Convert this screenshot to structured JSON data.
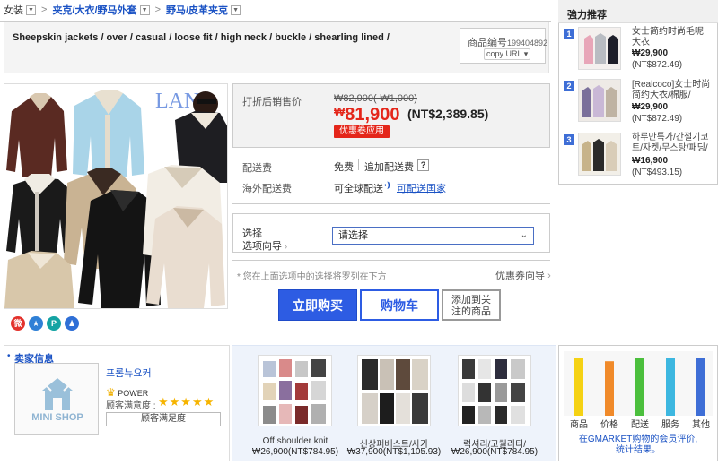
{
  "breadcrumb": {
    "items": [
      "女装",
      "夹克/大衣/野马外套",
      "野马/皮革夹克"
    ]
  },
  "product": {
    "title": "Sheepskin jackets / over / casual / loose fit / high neck / buckle / shearling lined /",
    "code_label": "商品编号",
    "code_value": "199404892",
    "copy_label": "copy URL"
  },
  "price": {
    "label": "打折后销售价",
    "original": "₩82,900(-₩1,000)",
    "currency_symbol": "₩",
    "current": "81,900",
    "nt": "(NT$2,389.85)",
    "coupon_button": "优惠卷应用"
  },
  "shipping": {
    "fee_label": "配送费",
    "fee_value": "免费",
    "extra_label": "追加配送费",
    "help_icon": "?",
    "overseas_label": "海外配送费",
    "overseas_value": "可全球配送",
    "countries_link": "可配送国家"
  },
  "options": {
    "label_line1": "选择",
    "label_line2": "选项向导",
    "select_placeholder": "请选择",
    "note": "* 您在上面选项中的选择将罗列在下方",
    "coupon_guide": "优惠券向导"
  },
  "actions": {
    "buy_now": "立即购买",
    "cart": "购物车",
    "favorite_line1": "添加到关",
    "favorite_line2": "注的商品"
  },
  "sidebar": {
    "title": "強力推荐",
    "items": [
      {
        "rank": "1",
        "title": "女士简约时尚毛呢大衣",
        "price": "₩29,900",
        "nt": "(NT$872.49)"
      },
      {
        "rank": "2",
        "title": "[Realcoco]女士时尚简约大衣/棉服/",
        "price": "₩29,900",
        "nt": "(NT$872.49)"
      },
      {
        "rank": "3",
        "title": "하루만특가/간절기코트/자켓/무스탕/패딩/",
        "price": "₩16,900",
        "nt": "(NT$493.15)"
      }
    ]
  },
  "seller": {
    "section_title": "卖家信息",
    "shop_label": "MINI SHOP",
    "shop_name": "프롬뉴요커",
    "power_label": "POWER",
    "satisfaction_label": "顾客满意度 :",
    "stars": "★★★★★",
    "satisfaction_button": "顾客满足度"
  },
  "recommended": [
    {
      "name": "Off shoulder knit",
      "price": "₩26,900(NT$784.95)"
    },
    {
      "name": "신상퍼베스트/사가",
      "price": "₩37,900(NT$1,105.93)"
    },
    {
      "name": "럭셔리/고퀄리티/",
      "price": "₩26,900(NT$784.95)"
    }
  ],
  "rating": {
    "footer_line1": "在GMARKET购物的会员评价,",
    "footer_line2": "统计结果。",
    "colors": {
      "商品": "#f5d214",
      "价格": "#f08a2a",
      "配送": "#4bbf3d",
      "服务": "#3db7e0",
      "其他": "#3e6ed6"
    }
  },
  "chart_data": {
    "type": "bar",
    "categories": [
      "商品",
      "价格",
      "配送",
      "服务",
      "其他"
    ],
    "values": [
      100,
      95,
      100,
      100,
      100
    ],
    "ylim": [
      0,
      100
    ]
  },
  "colors": {
    "accent": "#2d5ce3",
    "price_red": "#e4261a",
    "link_blue": "#1a52c4"
  }
}
